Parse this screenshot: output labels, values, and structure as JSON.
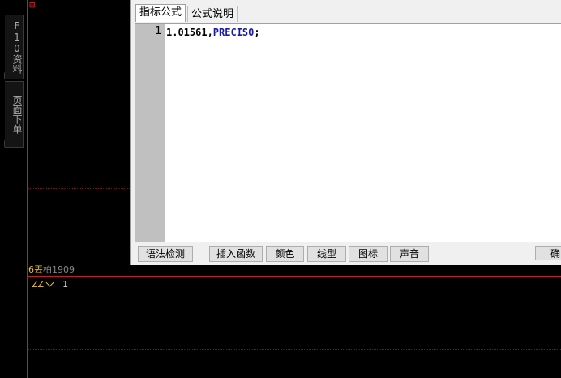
{
  "sidebar": {
    "tabs": [
      {
        "label": "F10资料"
      },
      {
        "label": "页面下单"
      }
    ]
  },
  "top_mark": "⊞",
  "sub_panel": {
    "title_prefix": "6",
    "title_char": "丟",
    "title_name": "柏1909",
    "indicator_name": "ZZ",
    "indicator_value": "1"
  },
  "editor_dialog": {
    "tabs": [
      {
        "label": "指标公式",
        "active": true
      },
      {
        "label": "公式说明",
        "active": false
      }
    ],
    "line_number": "1",
    "code_prefix": "1.01561,",
    "code_keyword": "PRECIS0",
    "code_suffix": ";",
    "buttons": {
      "syntax_check": "语法检测",
      "insert_function": "插入函数",
      "color": "颜色",
      "line_type": "线型",
      "icon": "图标",
      "sound": "声音",
      "confirm": "确"
    }
  },
  "colors": {
    "accent_red": "#c0202a",
    "indicator_yellow": "#e8c030",
    "keyword_blue": "#1a1aa0"
  }
}
